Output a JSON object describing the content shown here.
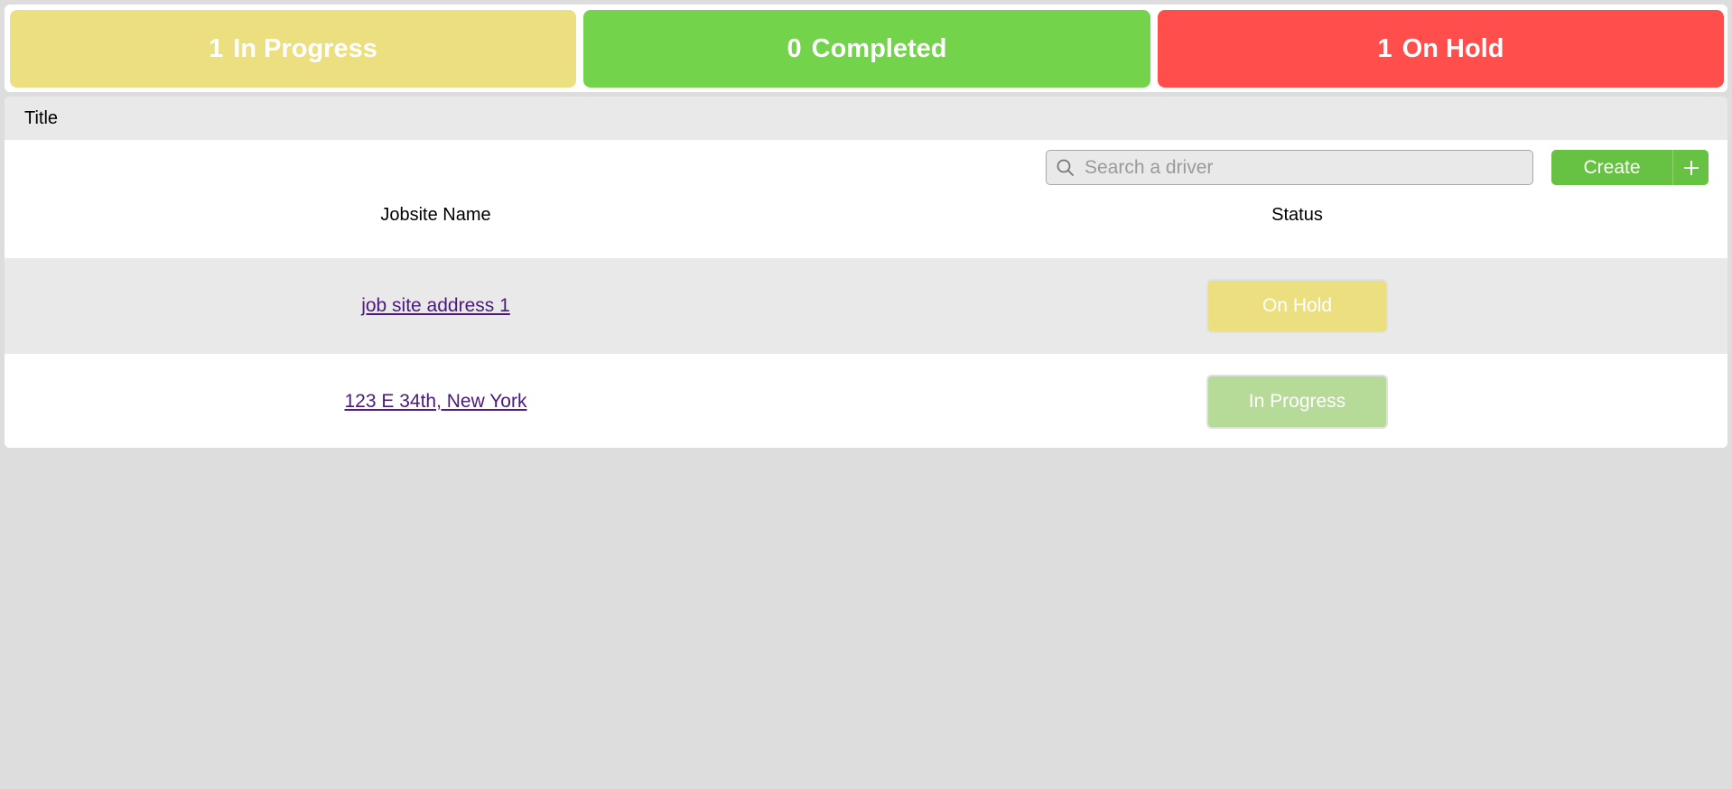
{
  "summary": {
    "in_progress": {
      "count": "1",
      "label": "In Progress",
      "color": "#ecdf7f"
    },
    "completed": {
      "count": "0",
      "label": "Completed",
      "color": "#73d34a"
    },
    "on_hold": {
      "count": "1",
      "label": "On Hold",
      "color": "#ff4e4c"
    }
  },
  "panel": {
    "title": "Title"
  },
  "search": {
    "placeholder": "Search a driver",
    "value": "",
    "icon": "search-icon"
  },
  "create_button": {
    "label": "Create",
    "icon": "plus-icon",
    "color": "#67c142"
  },
  "table": {
    "columns": [
      "Jobsite Name",
      "Status"
    ],
    "rows": [
      {
        "name": "job site address 1",
        "status": "On Hold",
        "status_color": "#ecdf7f"
      },
      {
        "name": "123 E 34th, New York",
        "status": "In Progress",
        "status_color": "#b6da98"
      }
    ]
  }
}
